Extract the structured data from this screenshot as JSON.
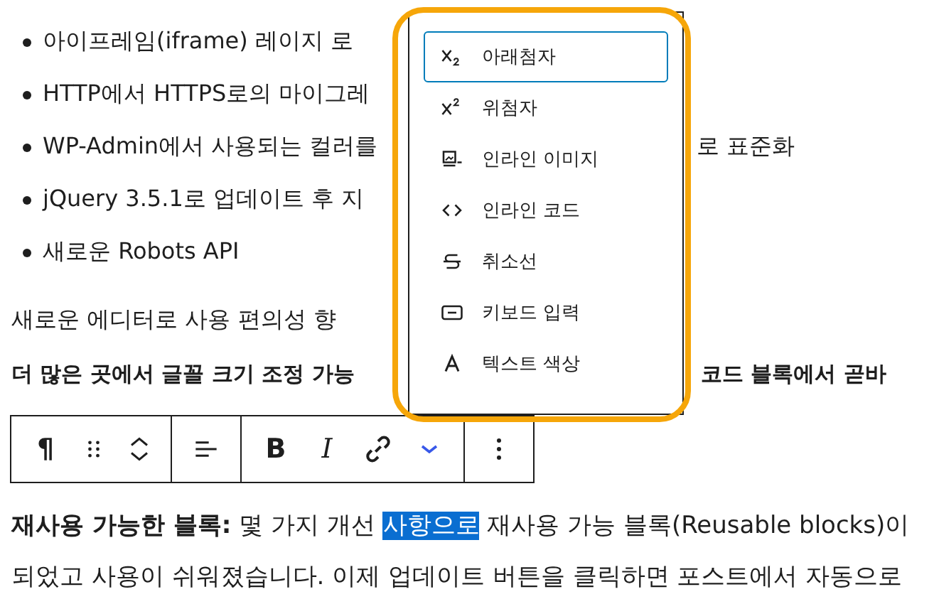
{
  "list_items": [
    {
      "text": "아이프레임(iframe) 레이지 로"
    },
    {
      "text": "HTTP에서 HTTPS로의 마이그레"
    },
    {
      "text": "WP-Admin에서 사용되는 컬러를",
      "continued": "로 표준화"
    },
    {
      "text": "jQuery 3.5.1로 업데이트 후 지"
    },
    {
      "text": "새로운 Robots API"
    }
  ],
  "paragraph": {
    "text": "새로운 에디터로 사용 편의성 향"
  },
  "heading_line": {
    "text": "더 많은 곳에서 글꼴 크기 조정 가능",
    "continued": "코드 블록에서 곧바"
  },
  "toolbar": {
    "groups": [
      [
        {
          "kind": "text",
          "label": "¶"
        },
        {
          "kind": "drag"
        },
        {
          "kind": "movers"
        }
      ],
      [
        {
          "kind": "align"
        }
      ],
      [
        {
          "kind": "bold",
          "label": "B"
        },
        {
          "kind": "italic",
          "label": "I"
        },
        {
          "kind": "link"
        },
        {
          "kind": "more-formats"
        }
      ],
      [
        {
          "kind": "options"
        }
      ]
    ]
  },
  "body_paragraph": {
    "lines": [
      [
        {
          "text": "재사용 가능한 블록:",
          "bold": true,
          "selected": false
        },
        {
          "text": " 몇 가지 개선 ",
          "bold": false,
          "selected": false
        },
        {
          "text": "사항으로",
          "bold": false,
          "selected": true
        },
        {
          "text": " 재사용 가능 블록(Reusable blocks)이",
          "bold": false,
          "selected": false
        }
      ],
      [
        {
          "text": "되었고 사용이 쉬워졌습니다. 이제 업데이트 버튼을 클릭하면 포스트에서 자동으로",
          "bold": false,
          "selected": false
        }
      ]
    ]
  },
  "format_menu": {
    "items": [
      {
        "label": "아래첨자",
        "selected": true
      },
      {
        "label": "위첨자",
        "selected": false
      },
      {
        "label": "인라인 이미지",
        "selected": false
      },
      {
        "label": "인라인 코드",
        "selected": false
      },
      {
        "label": "취소선",
        "selected": false
      },
      {
        "label": "키보드 입력",
        "selected": false
      },
      {
        "label": "텍스트 색상",
        "selected": false
      }
    ]
  }
}
